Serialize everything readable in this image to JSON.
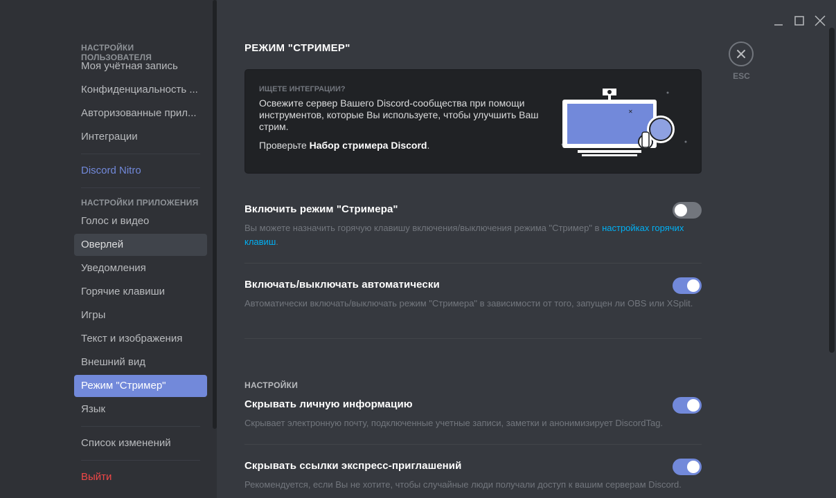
{
  "sidebar": {
    "user_settings_header": "НАСТРОЙКИ ПОЛЬЗОВАТЕЛЯ",
    "user_items": [
      "Моя учётная запись",
      "Конфиденциальность ...",
      "Авторизованные прил...",
      "Интеграции"
    ],
    "nitro": "Discord Nitro",
    "app_settings_header": "НАСТРОЙКИ ПРИЛОЖЕНИЯ",
    "app_items": [
      "Голос и видео",
      "Оверлей",
      "Уведомления",
      "Горячие клавиши",
      "Игры",
      "Текст и изображения",
      "Внешний вид",
      "Режим \"Стример\"",
      "Язык"
    ],
    "changelog": "Список изменений",
    "logout": "Выйти"
  },
  "page": {
    "title": "РЕЖИМ \"СТРИМЕР\""
  },
  "card": {
    "label": "ИЩЕТЕ ИНТЕГРАЦИИ?",
    "body": "Освежите сервер Вашего Discord-сообщества при помощи инструментов, которые Вы используете, чтобы улучшить Ваш стрим.",
    "cta_prefix": "Проверьте ",
    "cta_bold": "Набор стримера Discord",
    "cta_suffix": "."
  },
  "settings": {
    "enable_title": "Включить режим \"Стримера\"",
    "enable_desc_prefix": "Вы можете назначить горячую клавишу включения/выключения режима \"Стример\" в ",
    "enable_desc_link": "настройках горячих клавиш",
    "enable_desc_suffix": ".",
    "auto_title": "Включать/выключать автоматически",
    "auto_desc": "Автоматически включать/выключать режим \"Стримера\" в зависимости от того, запущен ли OBS или XSplit.",
    "section_label": "НАСТРОЙКИ",
    "hide_info_title": "Скрывать личную информацию",
    "hide_info_desc": "Скрывает электронную почту, подключенные учетные записи, заметки и анонимизирует DiscordTag.",
    "hide_links_title": "Скрывать ссылки экспресс-приглашений",
    "hide_links_desc": "Рекомендуется, если Вы не хотите, чтобы случайные люди получали доступ к вашим серверам Discord."
  },
  "toggles": {
    "enable": false,
    "auto": true,
    "hide_info": true,
    "hide_links": true
  },
  "close": {
    "esc_label": "ESC",
    "icon": "close-icon"
  },
  "colors": {
    "accent": "#7289da",
    "link": "#00b0f4",
    "danger": "#f04747",
    "background": "#36393f",
    "sidebar": "#2f3136"
  }
}
